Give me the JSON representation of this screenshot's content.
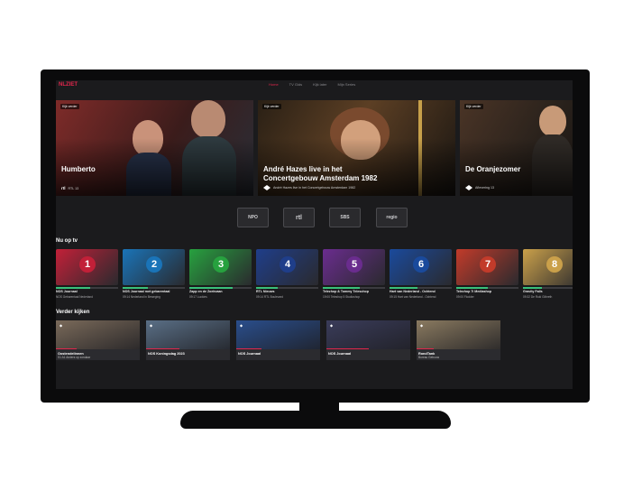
{
  "app": {
    "logo_text": "NLZIET",
    "nav": [
      "Home",
      "TV Gids",
      "Kijk later",
      "Mijn Series"
    ],
    "active_nav": 0
  },
  "hero": [
    {
      "badge": "Kijk verder",
      "title": "Humberto",
      "channel": "rtl",
      "meta": "RTL 13",
      "color": "#8b2c2a"
    },
    {
      "badge": "Kijk verder",
      "title": "André Hazes live in het Concertgebouw Amsterdam 1982",
      "channel_icon": "npo-icon",
      "meta": "André Hazes live in het Concertgebouw Amsterdam 1982",
      "color": "#5c3f24"
    },
    {
      "badge": "Kijk verder",
      "title": "De Oranjezomer",
      "channel_icon": "npo-icon",
      "meta": "Aflevering 13",
      "color": "#3a2a20"
    }
  ],
  "channels": [
    "NPO",
    "rtl",
    "SBS",
    "regio"
  ],
  "now_on_tv": {
    "title": "Nu op tv",
    "items": [
      {
        "caption": "NOS Journaal",
        "sub": "NOS Gebarentaal Nederland",
        "num": "1",
        "color": "#c22038",
        "progress": 0.55
      },
      {
        "caption": "NOS Journaal met gebarentaal",
        "sub": "09:14 Nederland in Beweging",
        "num": "2",
        "color": "#1a74b8",
        "progress": 0.4
      },
      {
        "caption": "Zapp en de Zoekvaan",
        "sub": "09:17 Luckies",
        "num": "3",
        "color": "#27a13f",
        "progress": 0.7
      },
      {
        "caption": "RTL Nieuws",
        "sub": "09:14 RTL Boulevard",
        "num": "4",
        "color": "#1f3e8a",
        "progress": 0.35
      },
      {
        "caption": "Telezhop & Tommy Teleschop",
        "sub": "19:00 Teleshop 5 Studioshop",
        "num": "5",
        "color": "#6a2c8e",
        "progress": 0.6
      },
      {
        "caption": "Hart van Nederland - Ochtend",
        "sub": "09:15 Hart van Nederland - Ochtend",
        "num": "6",
        "color": "#1a4a9c",
        "progress": 0.45
      },
      {
        "caption": "Telezhop 7i Mediashop",
        "sub": "09:00 Flodder",
        "num": "7",
        "color": "#c23b2a",
        "progress": 0.5
      },
      {
        "caption": "Gravity Falls",
        "sub": "09:32 De Ruki Gilbreth",
        "num": "8",
        "color": "#caa04a",
        "progress": 0.3
      }
    ]
  },
  "continue_watching": {
    "title": "Verder kijken",
    "items": [
      {
        "caption": "Oostendelinnen",
        "sub": "S1 A1 Anders op zondaar",
        "color": "#7a6a5a",
        "progress": 0.25
      },
      {
        "caption": "NOS Koningsdag 2023",
        "sub": "",
        "color": "#5a6f86",
        "progress": 0.4
      },
      {
        "caption": "NOS Journaal",
        "sub": "",
        "color": "#2a4e8c",
        "progress": 0.3
      },
      {
        "caption": "NOS Journaal",
        "sub": "",
        "color": "#3a3c5a",
        "progress": 0.5
      },
      {
        "caption": "RondTank",
        "sub": "Bureau Gebouw",
        "color": "#8a7a60",
        "progress": 0.2
      }
    ]
  }
}
